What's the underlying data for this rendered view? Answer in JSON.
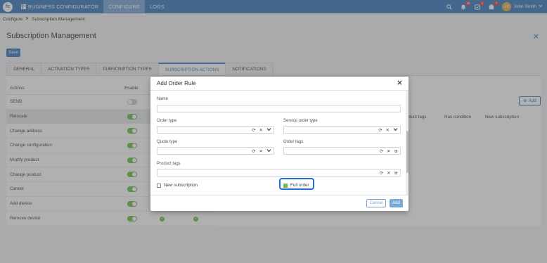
{
  "topbar": {
    "logo_text": "fc",
    "brand": "BUSINESS CONFIGURATOR",
    "nav_tabs": [
      {
        "label": "CONFIGURE",
        "active": true
      },
      {
        "label": "LOGS",
        "active": false
      }
    ],
    "badges": {
      "notifications": "30",
      "tasks": "6",
      "messages": "7"
    },
    "user": {
      "initials": "JS",
      "name": "John Smith"
    }
  },
  "breadcrumb": {
    "root": "Configure",
    "current": "Subscription Management"
  },
  "page": {
    "title": "Subscription Management",
    "save_label": "Save"
  },
  "tabs": [
    {
      "label": "GENERAL",
      "active": false
    },
    {
      "label": "ACTIVATION TYPES",
      "active": false
    },
    {
      "label": "SUBSCRIPTION TYPES",
      "active": false
    },
    {
      "label": "SUBSCRIPTION ACTIONS",
      "active": true
    },
    {
      "label": "NOTIFICATIONS",
      "active": false
    }
  ],
  "actions_table": {
    "headers": {
      "actions": "Actions",
      "enable": "Enable"
    },
    "rows": [
      {
        "label": "SEND",
        "enabled": false
      },
      {
        "label": "Relocate",
        "enabled": true,
        "selected": true
      },
      {
        "label": "Change address",
        "enabled": true
      },
      {
        "label": "Change configuration",
        "enabled": true
      },
      {
        "label": "Modify product",
        "enabled": true
      },
      {
        "label": "Change product",
        "enabled": true
      },
      {
        "label": "Cancel",
        "enabled": true
      },
      {
        "label": "Add device",
        "enabled": true
      },
      {
        "label": "Remove device",
        "enabled": true
      }
    ]
  },
  "rules_table": {
    "add_label": "Add",
    "headers": {
      "product_tags": "duct tags",
      "has_condition": "Has condition",
      "new_subscription": "New subscription"
    }
  },
  "modal": {
    "title": "Add Order Rule",
    "fields": {
      "name": "Name",
      "order_type": "Order type",
      "service_order_type": "Service order type",
      "quote_type": "Quote type",
      "order_tags": "Order tags",
      "product_tags": "Product tags"
    },
    "checkboxes": {
      "new_subscription": {
        "label": "New subscription",
        "checked": false
      },
      "full_order": {
        "label": "Full order",
        "checked": true
      }
    },
    "cancel_label": "Cancel",
    "add_label": "Add"
  },
  "colors": {
    "primary": "#3a7bbf",
    "toggle_on": "#6cc04a",
    "highlight": "#1f6fd6"
  }
}
